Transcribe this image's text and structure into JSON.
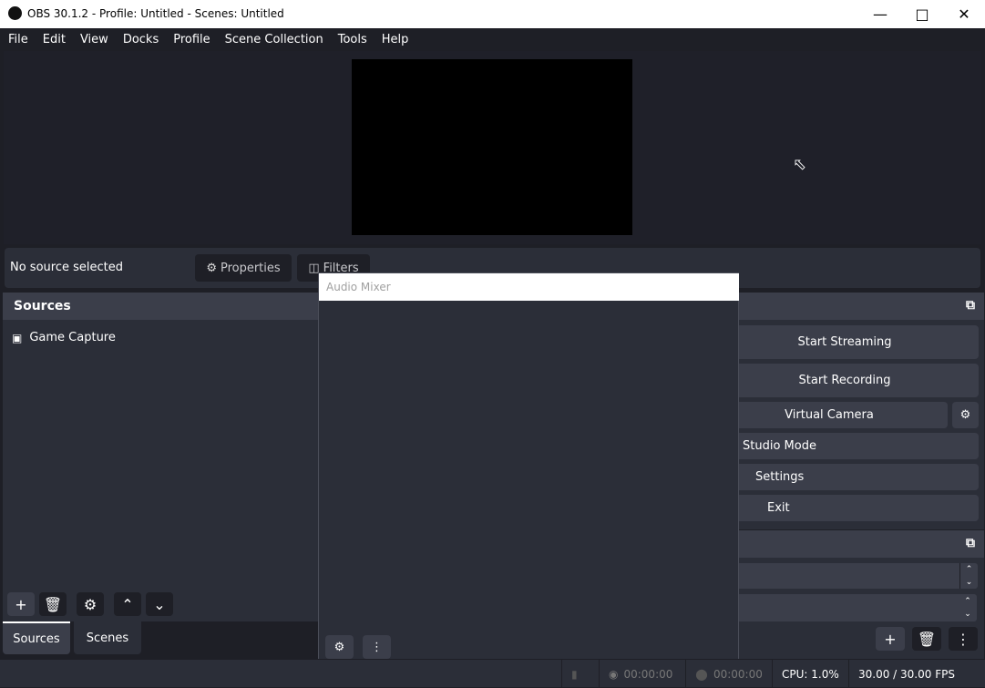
{
  "window": {
    "title": "OBS 30.1.2 - Profile: Untitled - Scenes: Untitled"
  },
  "menu": [
    "File",
    "Edit",
    "View",
    "Docks",
    "Profile",
    "Scene Collection",
    "Tools",
    "Help"
  ],
  "context": {
    "no_source": "No source selected",
    "properties": "Properties",
    "filters": "Filters"
  },
  "sources": {
    "title": "Sources",
    "items": [
      {
        "label": "Game Capture",
        "icon": "gamepad-icon"
      }
    ]
  },
  "tabs": [
    {
      "label": "Sources",
      "active": true
    },
    {
      "label": "Scenes",
      "active": false
    }
  ],
  "audio_mixer": {
    "title": "Audio Mixer"
  },
  "controls": {
    "start_streaming": "Start Streaming",
    "start_recording": "Start Recording",
    "virtual_camera": "Virtual Camera",
    "studio_mode": "Studio Mode",
    "settings": "Settings",
    "exit": "Exit"
  },
  "status": {
    "stream_time": "00:00:00",
    "record_time": "00:00:00",
    "cpu": "CPU: 1.0%",
    "fps": "30.00 / 30.00 FPS"
  },
  "colors": {
    "panel": "#2b2e38",
    "header": "#3b3e4a",
    "background": "#1e1f26"
  }
}
